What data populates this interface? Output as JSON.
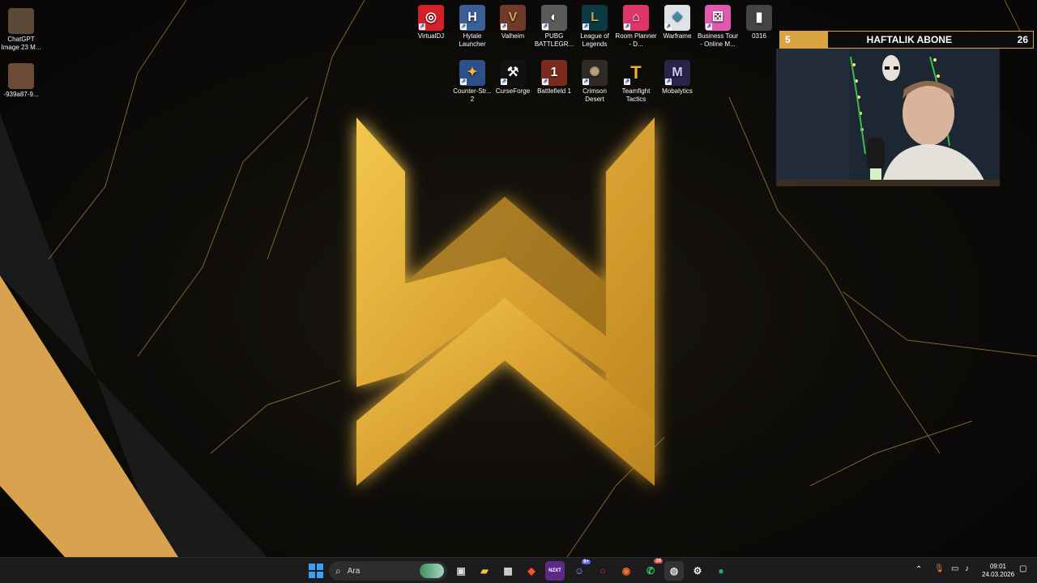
{
  "desktop": {
    "left_icons": [
      {
        "label": "ChatGPT Image 23 M...",
        "icon": "image-thumbnail-icon"
      },
      {
        "label": "-939a87-9...",
        "icon": "image-thumbnail-icon"
      }
    ],
    "top_row": [
      {
        "label": "VirtualDJ",
        "icon": "virtualdj-icon",
        "color": "#d3202a"
      },
      {
        "label": "Hytale Launcher",
        "icon": "hytale-icon",
        "color": "#3a5f96"
      },
      {
        "label": "Valheim",
        "icon": "valheim-icon",
        "color": "#6f3a2a"
      },
      {
        "label": "PUBG BATTLEGR...",
        "icon": "pubg-icon",
        "color": "#5a5a5a"
      },
      {
        "label": "League of Legends",
        "icon": "league-icon",
        "color": "#0b3a44"
      },
      {
        "label": "Room Planner - D...",
        "icon": "room-planner-icon",
        "color": "#e0356b"
      },
      {
        "label": "Warframe",
        "icon": "warframe-icon",
        "color": "#dfe3e7"
      },
      {
        "label": "Business Tour - Online M...",
        "icon": "business-tour-icon",
        "color": "#e25ab0"
      },
      {
        "label": "0316",
        "icon": "file-icon",
        "color": "#444444"
      }
    ],
    "second_row": [
      {
        "label": "Counter-Str... 2",
        "icon": "counter-strike-icon",
        "color": "#2d4f8a"
      },
      {
        "label": "CurseForge",
        "icon": "curseforge-icon",
        "color": "#111111"
      },
      {
        "label": "Battlefield 1",
        "icon": "battlefield-icon",
        "color": "#7b2a1e"
      },
      {
        "label": "Crimson Desert",
        "icon": "crimson-desert-icon",
        "color": "#2e2a26"
      },
      {
        "label": "Teamfight Tactics",
        "icon": "teamfight-tactics-icon",
        "color": "#f0b323"
      },
      {
        "label": "Mobalytics",
        "icon": "mobalytics-icon",
        "color": "#2a2448"
      }
    ]
  },
  "overlay": {
    "sub_title": "HAFTALIK ABONE",
    "sub_current": "5",
    "sub_goal": "26",
    "sub_progress_fraction": 0.19,
    "accent": "#d9a441"
  },
  "taskbar": {
    "search_placeholder": "Ara",
    "apps": [
      {
        "name": "start",
        "icon": "windows-start-icon"
      },
      {
        "name": "task-view",
        "icon": "task-view-icon"
      },
      {
        "name": "file-explorer",
        "icon": "folder-icon"
      },
      {
        "name": "store",
        "icon": "store-icon"
      },
      {
        "name": "brave",
        "icon": "brave-icon"
      },
      {
        "name": "nzxt",
        "icon": "nzxt-icon",
        "label": "NZXT"
      },
      {
        "name": "discord",
        "icon": "discord-icon",
        "badge": "9+"
      },
      {
        "name": "opera",
        "icon": "opera-icon"
      },
      {
        "name": "origin",
        "icon": "origin-icon"
      },
      {
        "name": "whatsapp",
        "icon": "whatsapp-icon",
        "badge": "30"
      },
      {
        "name": "obs",
        "icon": "obs-icon"
      },
      {
        "name": "steam",
        "icon": "steam-icon"
      },
      {
        "name": "spotify",
        "icon": "spotify-icon"
      }
    ],
    "time": "09:01",
    "date": "24.03.2026"
  }
}
